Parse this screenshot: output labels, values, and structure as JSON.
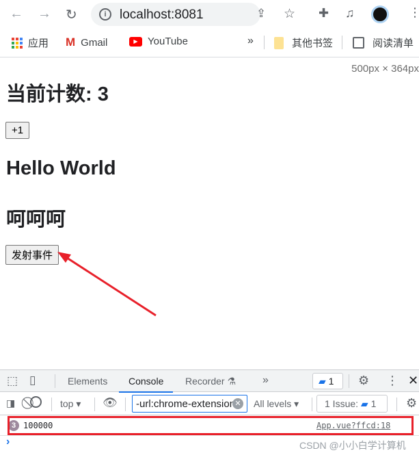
{
  "browser": {
    "url": "localhost:8081",
    "bookmarks": [
      {
        "label": "应用",
        "icon": "apps-grid-icon"
      },
      {
        "label": "Gmail",
        "icon": "gmail-icon"
      },
      {
        "label": "YouTube",
        "icon": "youtube-icon"
      }
    ],
    "overflow": "»",
    "other_bookmarks": "其他书签",
    "reading_list": "阅读清单"
  },
  "page": {
    "size_overlay": "500px × 364px",
    "count_heading": "当前计数: 3",
    "increment_button": "+1",
    "hello": "Hello World",
    "hehe": "呵呵呵",
    "emit_button": "发射事件"
  },
  "devtools": {
    "tabs": [
      "Elements",
      "Console",
      "Recorder"
    ],
    "active_tab": "Console",
    "more": "»",
    "message_badge": "1",
    "context": "top",
    "filter_value": "-url:chrome-extension",
    "levels": "All levels",
    "issues_label": "1 Issue:",
    "issues_count": "1",
    "log": {
      "repeat_count": "3",
      "text": "100000",
      "source": "App.vue?ffcd:18"
    },
    "prompt": "›"
  },
  "watermark": "CSDN @小小白学计算机",
  "colors": {
    "annotation_red": "#e8202a",
    "active_tab": "#1a73e8"
  }
}
